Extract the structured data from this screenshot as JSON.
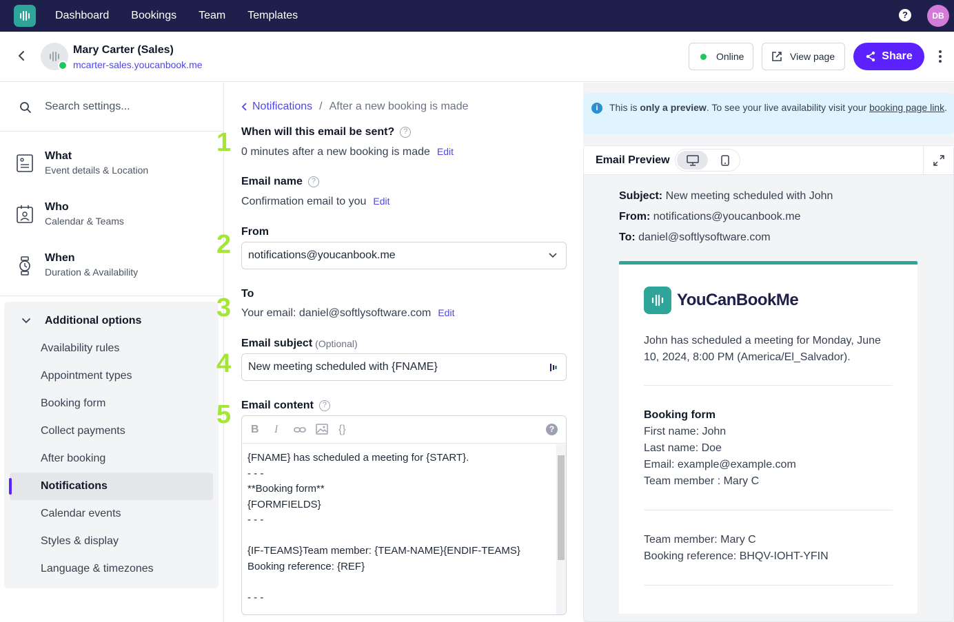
{
  "nav": {
    "items": [
      "Dashboard",
      "Bookings",
      "Team",
      "Templates"
    ],
    "help_icon": "help-icon",
    "avatar": "DB"
  },
  "profile": {
    "name": "Mary Carter (Sales)",
    "url": "mcarter-sales.youcanbook.me",
    "status": "Online",
    "view_page": "View page",
    "share": "Share"
  },
  "sidebar": {
    "search_placeholder": "Search settings...",
    "sections": [
      {
        "title": "What",
        "subtitle": "Event details & Location",
        "icon": "form-icon"
      },
      {
        "title": "Who",
        "subtitle": "Calendar & Teams",
        "icon": "calendar-person-icon"
      },
      {
        "title": "When",
        "subtitle": "Duration & Availability",
        "icon": "watch-icon"
      }
    ],
    "additional_options": "Additional options",
    "options": [
      "Availability rules",
      "Appointment types",
      "Booking form",
      "Collect payments",
      "After booking",
      "Notifications",
      "Calendar events",
      "Styles & display",
      "Language & timezones"
    ],
    "active_option": "Notifications"
  },
  "center": {
    "breadcrumb_link": "Notifications",
    "breadcrumb_sep": "/",
    "breadcrumb_current": "After a new booking is made",
    "numbers": [
      "1",
      "2",
      "3",
      "4",
      "5"
    ],
    "when_label": "When will this email be sent?",
    "when_value": "0 minutes after a new booking is made",
    "edit": "Edit",
    "name_label": "Email name",
    "name_value": "Confirmation email to you",
    "from_label": "From",
    "from_value": "notifications@youcanbook.me",
    "to_label": "To",
    "to_value": "Your email: daniel@softlysoftware.com",
    "subject_label": "Email subject",
    "subject_optional": "(Optional)",
    "subject_value": "New meeting scheduled with {FNAME}",
    "content_label": "Email content",
    "content_text": "{FNAME} has scheduled a meeting for {START}.\n- - -\n**Booking form**\n{FORMFIELDS}\n- - -\n\n{IF-TEAMS}Team member: {TEAM-NAME}{ENDIF-TEAMS}\nBooking reference: {REF}\n\n- - -"
  },
  "preview": {
    "notice_pre": "This is ",
    "notice_bold": "only a preview",
    "notice_mid": ". To see your live availability visit your ",
    "notice_link": "booking page link",
    "notice_end": ".",
    "title": "Email Preview",
    "subject_key": "Subject:",
    "subject_val": "New meeting scheduled with John",
    "from_key": "From:",
    "from_val": "notifications@youcanbook.me",
    "to_key": "To:",
    "to_val": "daniel@softlysoftware.com",
    "brand": "YouCanBookMe",
    "intro": "John has scheduled a meeting for Monday, June 10, 2024, 8:00 PM (America/El_Salvador).",
    "form_title": "Booking form",
    "fields": [
      "First name: John",
      "Last name: Doe",
      "Email: example@example.com",
      "Team member : Mary C"
    ],
    "team_member": "Team member: Mary C",
    "booking_ref": "Booking reference: BHQV-IOHT-YFIN"
  },
  "colors": {
    "nav": "#1e1f4b",
    "accent": "#5b21ff",
    "brand": "#2fa59a",
    "link": "#4f46e5",
    "marker": "#a3e635"
  }
}
